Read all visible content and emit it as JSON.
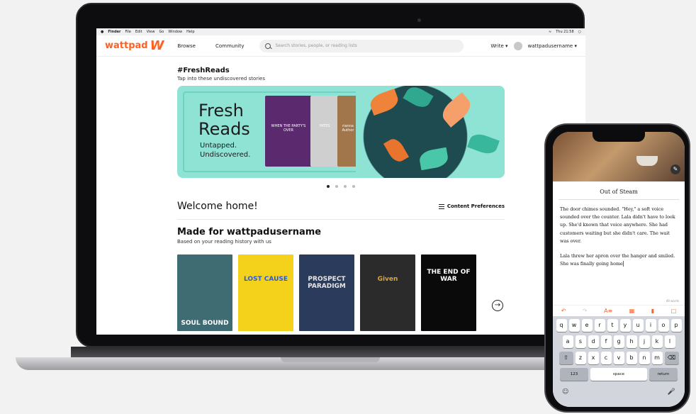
{
  "menubar": {
    "items": [
      "Finder",
      "File",
      "Edit",
      "View",
      "Go",
      "Window",
      "Help"
    ],
    "clock": "Thu 21:58"
  },
  "header": {
    "logo_text": "wattpad",
    "logo_mark": "W",
    "nav_browse": "Browse",
    "nav_community": "Community",
    "search_placeholder": "Search stories, people, or reading lists",
    "write": "Write",
    "username": "wattpadusername"
  },
  "fresh_reads": {
    "title": "#FreshReads",
    "subtitle": "Tap into these undiscovered stories",
    "banner_headline_1": "Fresh",
    "banner_headline_2": "Reads",
    "banner_tag_1": "Untapped.",
    "banner_tag_2": "Undiscovered.",
    "covers": [
      {
        "name": "when-the-party-s-over",
        "color": "#5b2a6e",
        "text": "WHEN THE PARTY'S OVER"
      },
      {
        "name": "fates",
        "color": "#cfcfcf",
        "text": "FATES"
      },
      {
        "name": "rianna-author",
        "color": "#a0764a",
        "text": "rianna Author"
      }
    ],
    "carousel_dots": 4,
    "active_dot": 0
  },
  "welcome": {
    "text": "Welcome home!",
    "content_prefs": "Content Preferences"
  },
  "made_for": {
    "title": "Made for wattpadusername",
    "subtitle": "Based on your reading history with us",
    "books": [
      {
        "title": "SOUL BOUND",
        "color": "#3f6b73",
        "text_color": "#ffffff"
      },
      {
        "title": "LOST CAUSE",
        "color": "#f4d21c",
        "text_color": "#2a5bd7"
      },
      {
        "title": "PROSPECT PARADIGM",
        "color": "#2a3b5c",
        "text_color": "#e6e6e6"
      },
      {
        "title": "Given",
        "color": "#2b2b2b",
        "text_color": "#d9a441"
      },
      {
        "title": "THE END OF WAR",
        "color": "#0a0a0a",
        "text_color": "#ffffff"
      }
    ]
  },
  "phone": {
    "story_title": "Out of Steam",
    "para1": "The door chimes sounded. \"Hey,\" a soft voice sounded over the counter. Lala didn't have to look up. She'd known that voice anywhere. She had customers waiting but she didn't care. The wait was over.",
    "para2": "Lala threw her apron over the hanger and smiled. She was finally going home",
    "word_count": "49 words",
    "keyboard": {
      "row1": [
        "q",
        "w",
        "e",
        "r",
        "t",
        "y",
        "u",
        "i",
        "o",
        "p"
      ],
      "row2": [
        "a",
        "s",
        "d",
        "f",
        "g",
        "h",
        "j",
        "k",
        "l"
      ],
      "row3": [
        "z",
        "x",
        "c",
        "v",
        "b",
        "n",
        "m"
      ],
      "numbers": "123",
      "space": "space",
      "return": "return"
    }
  }
}
